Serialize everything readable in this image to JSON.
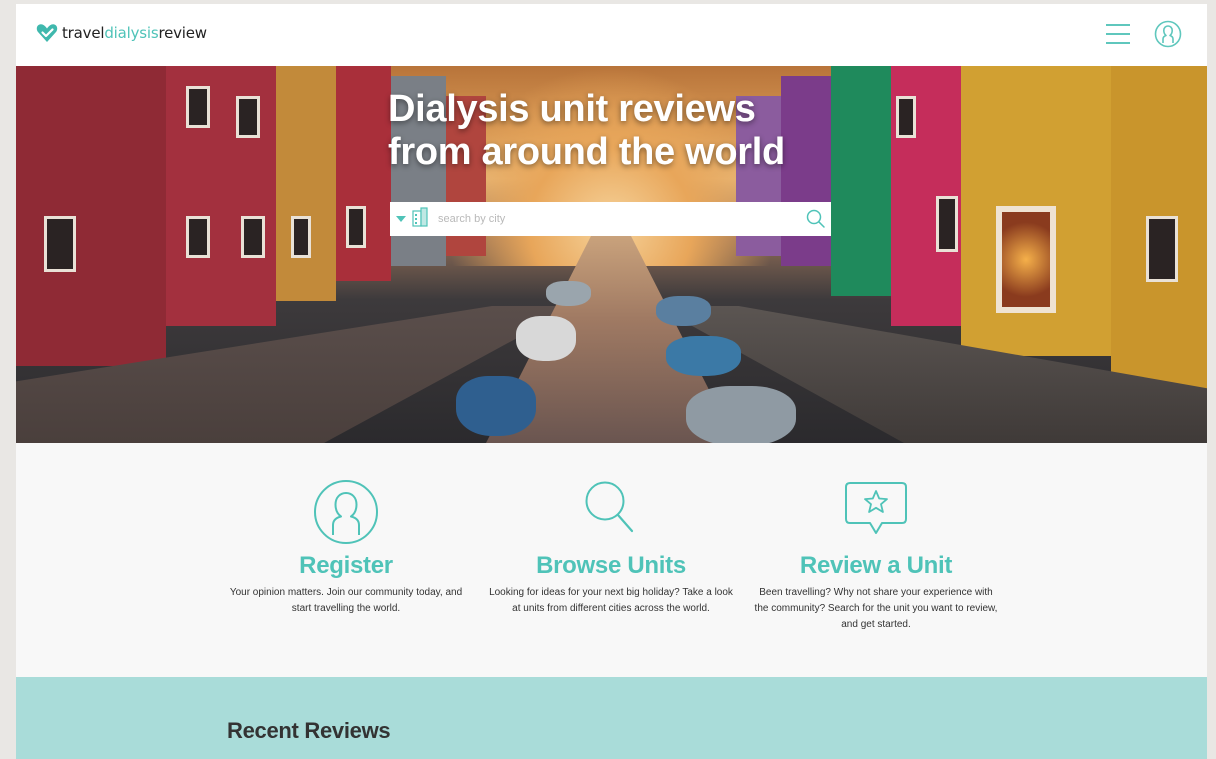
{
  "brand": {
    "part1": "travel",
    "part2": "dialysis",
    "part3": "review",
    "accent": "#4fc3b8"
  },
  "header": {
    "menu_icon": "hamburger-icon",
    "user_icon": "user-circle-icon"
  },
  "hero": {
    "title": "Dialysis unit reviews from around the world",
    "search": {
      "placeholder": "search by city",
      "value": ""
    }
  },
  "features": [
    {
      "icon": "user-circle-icon",
      "title": "Register",
      "text": "Your opinion matters. Join our community today, and start travelling the world."
    },
    {
      "icon": "search-icon",
      "title": "Browse Units",
      "text": "Looking for ideas for your next big holiday? Take a look at units from different cities across the world."
    },
    {
      "icon": "star-speech-bubble-icon",
      "title": "Review a Unit",
      "text": "Been travelling? Why not share your experience with the community? Search for the unit you want to review, and get started."
    }
  ],
  "recent": {
    "title": "Recent Reviews",
    "background": "#a9dcd9"
  }
}
